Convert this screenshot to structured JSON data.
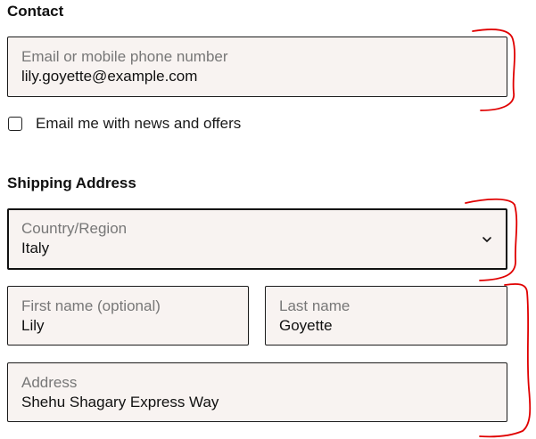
{
  "contact": {
    "title": "Contact",
    "email_field": {
      "label": "Email or mobile phone number",
      "value": "lily.goyette@example.com"
    },
    "newsletter": {
      "label": "Email me with news and offers",
      "checked": false
    }
  },
  "shipping": {
    "title": "Shipping Address",
    "country": {
      "label": "Country/Region",
      "value": "Italy",
      "icon": "chevron-down-icon"
    },
    "first_name": {
      "label": "First name (optional)",
      "value": "Lily"
    },
    "last_name": {
      "label": "Last name",
      "value": "Goyette"
    },
    "address": {
      "label": "Address",
      "value": "Shehu Shagary Express Way"
    }
  },
  "colors": {
    "field_background": "#f8f3f1",
    "field_border": "#1b1b1b",
    "annotation": "#e00000"
  }
}
